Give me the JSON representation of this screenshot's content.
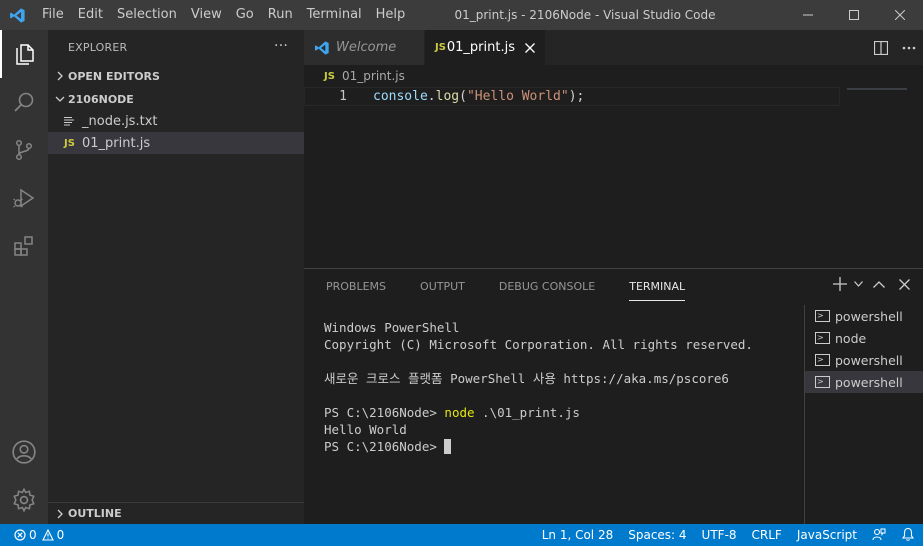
{
  "window": {
    "title": "01_print.js - 2106Node - Visual Studio Code",
    "menu": [
      "File",
      "Edit",
      "Selection",
      "View",
      "Go",
      "Run",
      "Terminal",
      "Help"
    ]
  },
  "sidebar": {
    "header": "EXPLORER",
    "more": "···",
    "open_editors": "OPEN EDITORS",
    "folder": "2106NODE",
    "files": [
      {
        "name": "_node.js.txt",
        "type": "txt"
      },
      {
        "name": "01_print.js",
        "type": "js",
        "badge": "JS"
      }
    ],
    "outline": "OUTLINE"
  },
  "tabs": [
    {
      "label": "Welcome",
      "active": false
    },
    {
      "label": "01_print.js",
      "active": true,
      "badge": "JS"
    }
  ],
  "breadcrumb": {
    "badge": "JS",
    "file": "01_print.js"
  },
  "editor": {
    "line_number": "1",
    "tokens": {
      "obj": "console",
      "dot": ".",
      "fn": "log",
      "open": "(",
      "str": "\"Hello World\"",
      "close": ");"
    }
  },
  "panel": {
    "tabs": [
      "PROBLEMS",
      "OUTPUT",
      "DEBUG CONSOLE",
      "TERMINAL"
    ],
    "active_tab": "TERMINAL",
    "terminal_lines": [
      "Windows PowerShell",
      "Copyright (C) Microsoft Corporation. All rights reserved.",
      "",
      "새로운 크로스 플랫폼 PowerShell 사용 https://aka.ms/pscore6",
      ""
    ],
    "prompt": "PS C:\\2106Node> ",
    "command": "node",
    "command_args": " .\\01_print.js",
    "output": "Hello World",
    "final_prompt": "PS C:\\2106Node> ",
    "terminals": [
      "powershell",
      "node",
      "powershell",
      "powershell"
    ],
    "selected_terminal": 3
  },
  "statusbar": {
    "errors": "0",
    "warnings": "0",
    "position": "Ln 1, Col 28",
    "spaces": "Spaces: 4",
    "encoding": "UTF-8",
    "eol": "CRLF",
    "language": "JavaScript"
  },
  "colors": {
    "accent": "#007acc",
    "titlebar": "#3c3c3c",
    "activitybar": "#333333",
    "sidebar": "#252526",
    "editor": "#1e1e1e",
    "js_badge": "#cbcb41"
  }
}
